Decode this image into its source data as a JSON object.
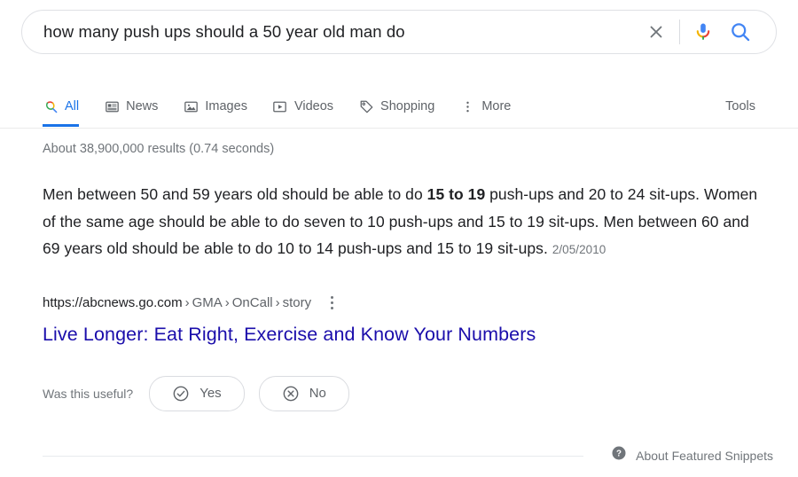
{
  "search": {
    "query": "how many push ups should a 50 year old man do",
    "placeholder": "Search",
    "clear_icon": "close-icon",
    "mic_icon": "microphone-icon",
    "search_icon": "search-icon",
    "accent_blue": "#1a73e8",
    "mic_colors": {
      "body": "#4285f4",
      "left_arc": "#f4b400",
      "right_arc": "#ea4335",
      "stem": "#34a853"
    }
  },
  "nav": {
    "tabs": [
      {
        "label": "All",
        "icon": "search-icon",
        "active": true
      },
      {
        "label": "News",
        "icon": "news-icon",
        "active": false
      },
      {
        "label": "Images",
        "icon": "image-icon",
        "active": false
      },
      {
        "label": "Videos",
        "icon": "video-play-icon",
        "active": false
      },
      {
        "label": "Shopping",
        "icon": "tag-icon",
        "active": false
      },
      {
        "label": "More",
        "icon": "more-vertical-icon",
        "active": false
      }
    ],
    "tools_label": "Tools"
  },
  "results": {
    "stats": "About 38,900,000 results (0.74 seconds)",
    "snippet": {
      "part1": "Men between 50 and 59 years old should be able to do ",
      "bold": "15 to 19",
      "part2": " push-ups and 20 to 24 sit-ups. Women of the same age should be able to do seven to 10 push-ups and 15 to 19 sit-ups. Men between 60 and 69 years old should be able to do 10 to 14 push-ups and 15 to 19 sit-ups.",
      "date": "2/05/2010"
    },
    "source": {
      "domain": "https://abcnews.go.com",
      "crumbs": [
        "GMA",
        "OnCall",
        "story"
      ],
      "separator": "›",
      "kebab_icon": "more-vertical-icon"
    },
    "title": "Live Longer: Eat Right, Exercise and Know Your Numbers",
    "title_color": "#1a0dab"
  },
  "feedback": {
    "question": "Was this useful?",
    "yes_label": "Yes",
    "yes_icon": "check-circle-icon",
    "no_label": "No",
    "no_icon": "x-circle-icon"
  },
  "footer": {
    "about_label": "About Featured Snippets",
    "help_icon": "help-circle-icon"
  }
}
